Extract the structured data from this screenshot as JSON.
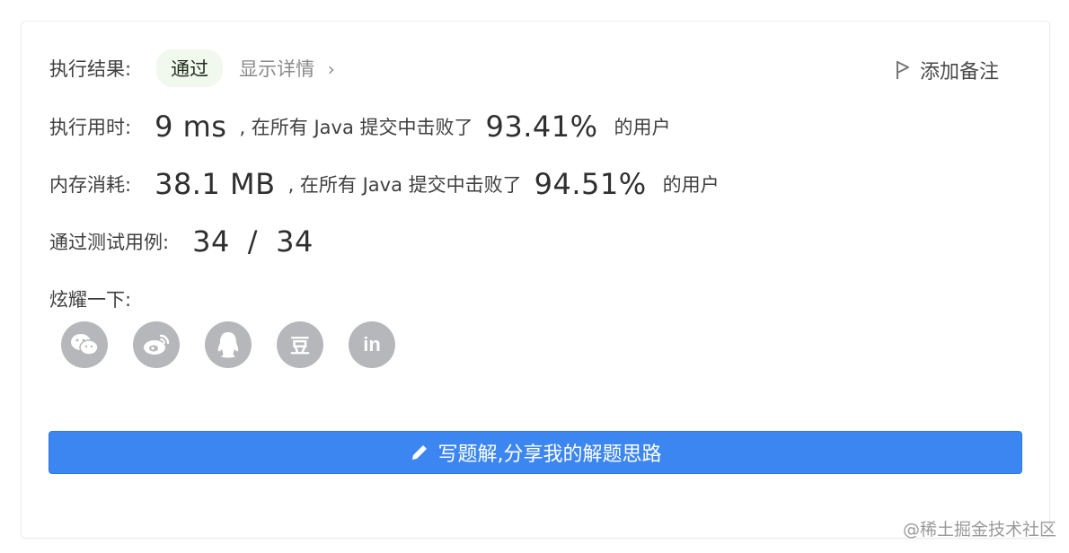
{
  "result": {
    "label": "执行结果:",
    "status": "通过",
    "details_link": "显示详情",
    "add_note": "添加备注"
  },
  "runtime": {
    "label": "执行用时:",
    "value": "9 ms",
    "middle": ", 在所有 Java 提交中击败了",
    "percent": "93.41%",
    "suffix": "的用户"
  },
  "memory": {
    "label": "内存消耗:",
    "value": "38.1 MB",
    "middle": ", 在所有 Java 提交中击败了",
    "percent": "94.51%",
    "suffix": "的用户"
  },
  "tests": {
    "label": "通过测试用例:",
    "passed": "34",
    "separator": "/",
    "total": "34"
  },
  "share": {
    "label": "炫耀一下:",
    "icons": [
      "wechat-icon",
      "weibo-icon",
      "qq-icon",
      "douban-icon",
      "linkedin-icon"
    ],
    "douban_glyph": "豆",
    "linkedin_glyph": "in"
  },
  "cta": {
    "label": "写题解,分享我的解题思路"
  },
  "watermark": "@稀土掘金技术社区",
  "colors": {
    "accent": "#3b86f0",
    "pass_bg": "#f1f8ee",
    "icon_gray": "#b6b7ba"
  }
}
